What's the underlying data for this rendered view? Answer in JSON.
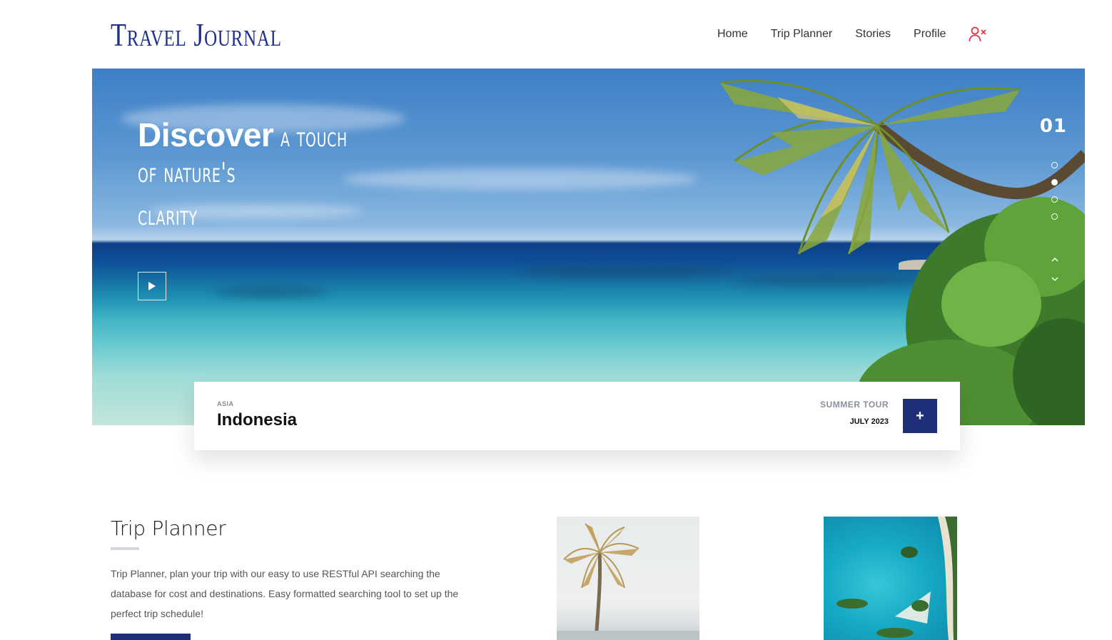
{
  "app": {
    "logo_text": "Travel Journal"
  },
  "nav": {
    "items": [
      "Home",
      "Trip Planner",
      "Stories",
      "Profile"
    ],
    "user_icon": "user-x-icon",
    "accent_color": "#e0364a"
  },
  "hero": {
    "title_strong": "Discover",
    "title_line1": "a touch",
    "title_line2": "of nature's",
    "title_line3": "clarity",
    "slide_number": "01",
    "slides_total_dots": 4,
    "active_dot": 2,
    "play_icon": "play-icon",
    "up_icon": "chevron-up-icon",
    "down_icon": "chevron-down-icon"
  },
  "card": {
    "region": "ASIA",
    "country": "Indonesia",
    "tour_label": "SUMMER TOUR",
    "tour_date": "JULY 2023",
    "action_label": "+",
    "brand_color": "#1f2f7a"
  },
  "trip_planner": {
    "title": "Trip Planner",
    "description": "Trip Planner, plan your trip with our easy to use RESTful API searching the database for cost and destinations. Easy formatted searching tool to set up the perfect trip schedule!"
  }
}
